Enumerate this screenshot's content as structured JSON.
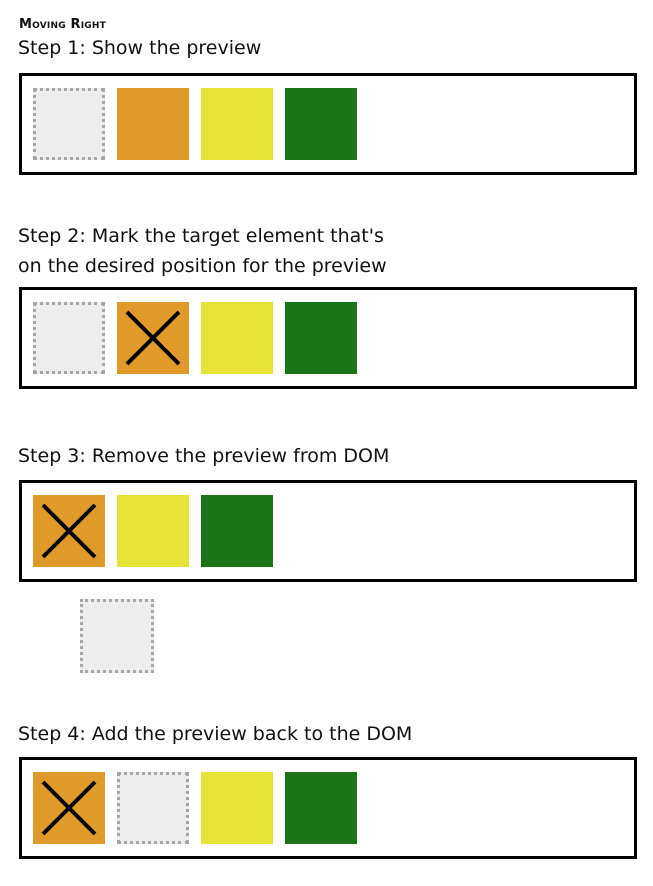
{
  "heading": "Moving Right",
  "colors": {
    "orange": "#e09a2a",
    "yellow": "#e5e336",
    "green": "#1c7419",
    "preview_fill": "#ededed",
    "preview_border": "#a6a6a6",
    "frame": "#000000"
  },
  "steps": [
    {
      "lines": [
        "Step 1: Show the preview"
      ],
      "tiles": [
        {
          "kind": "preview"
        },
        {
          "kind": "orange"
        },
        {
          "kind": "yellow"
        },
        {
          "kind": "green"
        }
      ]
    },
    {
      "lines": [
        "Step 2: Mark the target element that's",
        "on the desired position for the preview"
      ],
      "tiles": [
        {
          "kind": "preview"
        },
        {
          "kind": "orange",
          "marked": true
        },
        {
          "kind": "yellow"
        },
        {
          "kind": "green"
        }
      ]
    },
    {
      "lines": [
        "Step 3: Remove the preview from DOM"
      ],
      "tiles": [
        {
          "kind": "orange",
          "marked": true
        },
        {
          "kind": "yellow"
        },
        {
          "kind": "green"
        }
      ],
      "detached": {
        "kind": "preview"
      }
    },
    {
      "lines": [
        "Step 4: Add the preview back to the DOM"
      ],
      "tiles": [
        {
          "kind": "orange",
          "marked": true
        },
        {
          "kind": "preview"
        },
        {
          "kind": "yellow"
        },
        {
          "kind": "green"
        }
      ]
    }
  ]
}
